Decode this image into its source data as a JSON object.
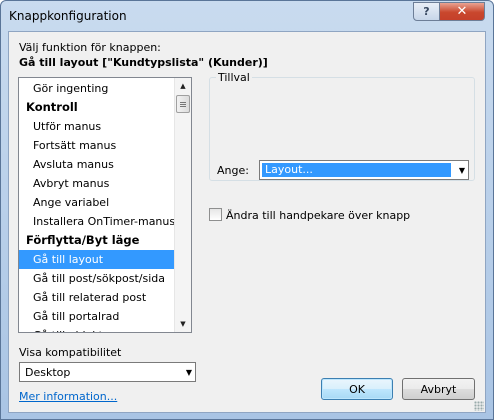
{
  "window": {
    "title": "Knappkonfiguration"
  },
  "titlebar": {
    "help_label": "?",
    "close_label": "✕"
  },
  "prompt_label": "Välj funktion för knappen:",
  "button_function": "Gå till layout [\"Kundtypslista\" (Kunder)]",
  "function_list": {
    "items": [
      {
        "label": "Gör ingenting",
        "type": "item"
      },
      {
        "label": "Kontroll",
        "type": "heading"
      },
      {
        "label": "Utför manus",
        "type": "item"
      },
      {
        "label": "Fortsätt manus",
        "type": "item"
      },
      {
        "label": "Avsluta manus",
        "type": "item"
      },
      {
        "label": "Avbryt manus",
        "type": "item"
      },
      {
        "label": "Ange variabel",
        "type": "item"
      },
      {
        "label": "Installera OnTimer-manus",
        "type": "item"
      },
      {
        "label": "Förflytta/Byt läge",
        "type": "heading"
      },
      {
        "label": "Gå till layout",
        "type": "item",
        "selected": true
      },
      {
        "label": "Gå till post/sökpost/sida",
        "type": "item"
      },
      {
        "label": "Gå till relaterad post",
        "type": "item"
      },
      {
        "label": "Gå till portalrad",
        "type": "item"
      },
      {
        "label": "Gå till objekt",
        "type": "item"
      }
    ],
    "scroll_up_icon": "▲",
    "scroll_down_icon": "▼"
  },
  "options": {
    "group_label": "Tillval",
    "ange_label": "Ange:",
    "ange_value": "Layout...",
    "dropdown_icon": "▼",
    "checkbox_label": "Ändra till handpekare över knapp",
    "checkbox_checked": false
  },
  "compat": {
    "label": "Visa kompatibilitet",
    "value": "Desktop"
  },
  "more_info_link": "Mer information...",
  "buttons": {
    "ok": "OK",
    "cancel": "Avbryt"
  },
  "colors": {
    "selection": "#3399ff",
    "link": "#0066cc",
    "close_red": "#c9472d"
  }
}
